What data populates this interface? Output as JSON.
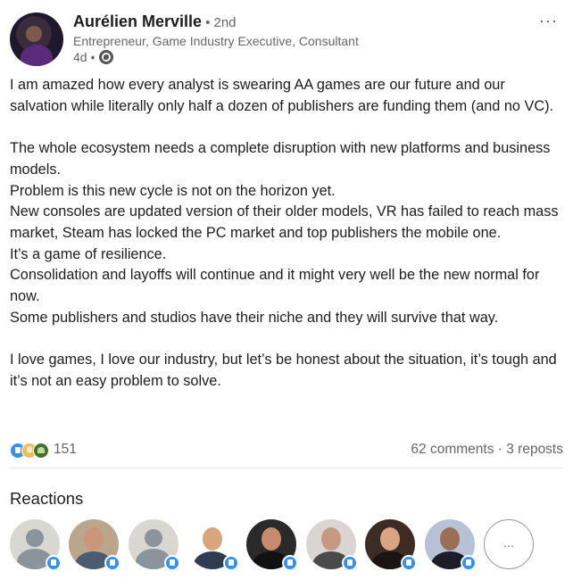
{
  "author": {
    "name": "Aurélien Merville",
    "degree": "• 2nd",
    "headline": "Entrepreneur, Game Industry Executive, Consultant",
    "time": "4d •",
    "visibility_icon": "globe-icon"
  },
  "menu": {
    "more_label": "···"
  },
  "post": {
    "paragraphs": [
      "I am amazed how every analyst is swearing AA games are our future and our salvation while literally only half a dozen of publishers are funding them (and no VC).",
      "",
      "The whole ecosystem needs a complete disruption with new platforms and business models.",
      "Problem is this new cycle is not on the horizon yet.",
      "New consoles are updated version of their older models, VR has failed to reach mass market, Steam has locked the PC market and top publishers the mobile one.",
      "It’s a game of resilience.",
      "Consolidation and layoffs will continue and it might very well be the new normal for now.",
      "Some publishers and studios have their niche and they will survive that way.",
      "",
      "I love games, I love our industry, but let’s be honest about the situation, it’s tough and it’s not an easy problem to solve."
    ]
  },
  "social": {
    "reaction_icons": [
      "like-icon",
      "insightful-icon",
      "support-icon"
    ],
    "reaction_count": "151",
    "counts": "62 comments · 3 reposts"
  },
  "reactions": {
    "title": "Reactions",
    "more_label": "…"
  },
  "colors": {
    "like": "#378fe9",
    "insightful": "#f5bb5c",
    "support": "#44712e",
    "secondary_text": "#666666"
  }
}
